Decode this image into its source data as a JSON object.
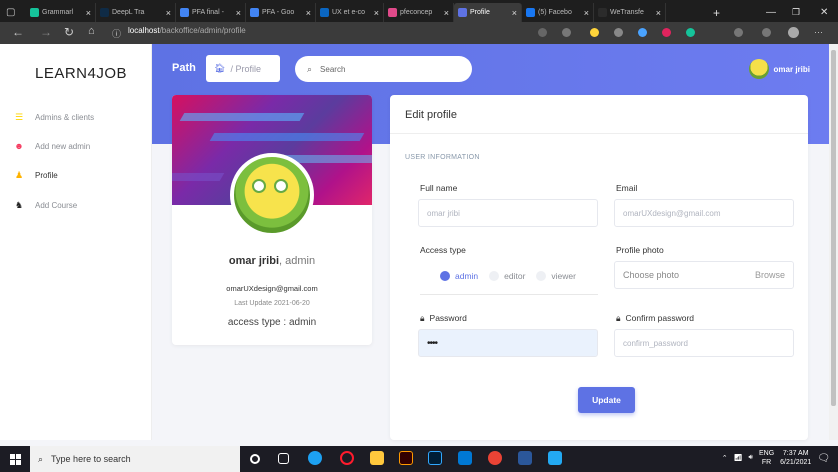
{
  "browser": {
    "tabs": [
      {
        "label": "Grammarl",
        "color": "#15c39a"
      },
      {
        "label": "DeepL Tra",
        "color": "#0f2b46"
      },
      {
        "label": "PFA final -",
        "color": "#4285f4"
      },
      {
        "label": "PFA - Goo",
        "color": "#4285f4"
      },
      {
        "label": "UX et e-co",
        "color": "#0a66c2"
      },
      {
        "label": "pfeconcep",
        "color": "#e04a8a"
      },
      {
        "label": "Profile",
        "color": "#5e72e4",
        "active": true
      },
      {
        "label": "(5) Facebo",
        "color": "#1877f2"
      },
      {
        "label": "WeTransfe",
        "color": "#2b2b2b"
      }
    ],
    "url_host": "localhost",
    "url_path": "/backoffice/admin/profile"
  },
  "sidebar": {
    "logo": "LEARN4JOB",
    "items": [
      {
        "label": "Admins & clients",
        "icon": "list-icon",
        "glyph": "☰",
        "color": "#ffd600"
      },
      {
        "label": "Add new admin",
        "icon": "user-plus-icon",
        "glyph": "☻",
        "color": "#f5365c"
      },
      {
        "label": "Profile",
        "icon": "user-icon",
        "glyph": "♟",
        "color": "#ffb300"
      },
      {
        "label": "Add Course",
        "icon": "users-icon",
        "glyph": "♞",
        "color": "#222"
      }
    ]
  },
  "header": {
    "path_label": "Path",
    "breadcrumb": "/ Profile",
    "search_placeholder": "Search",
    "user_name": "omar jribi"
  },
  "profile_card": {
    "name": "omar jribi",
    "role": ", admin",
    "email": "omarUXdesign@gmail.com",
    "last_update": "Last Update 2021-06-20",
    "access": "access type : admin"
  },
  "edit": {
    "title": "Edit profile",
    "section": "USER INFORMATION",
    "full_name_label": "Full name",
    "full_name_value": "omar jribi",
    "email_label": "Email",
    "email_value": "omarUXdesign@gmail.com",
    "access_label": "Access type",
    "access_options": [
      "admin",
      "editor",
      "viewer"
    ],
    "access_selected": "admin",
    "photo_label": "Profile photo",
    "photo_placeholder": "Choose photo",
    "browse": "Browse",
    "password_label": "Password",
    "password_value": "••••",
    "confirm_label": "Confirm password",
    "confirm_placeholder": "confirm_password",
    "update_button": "Update"
  },
  "taskbar": {
    "search_placeholder": "Type here to search",
    "lang": "ENG",
    "region": "FR",
    "time": "7:37 AM",
    "date": "6/21/2021"
  }
}
